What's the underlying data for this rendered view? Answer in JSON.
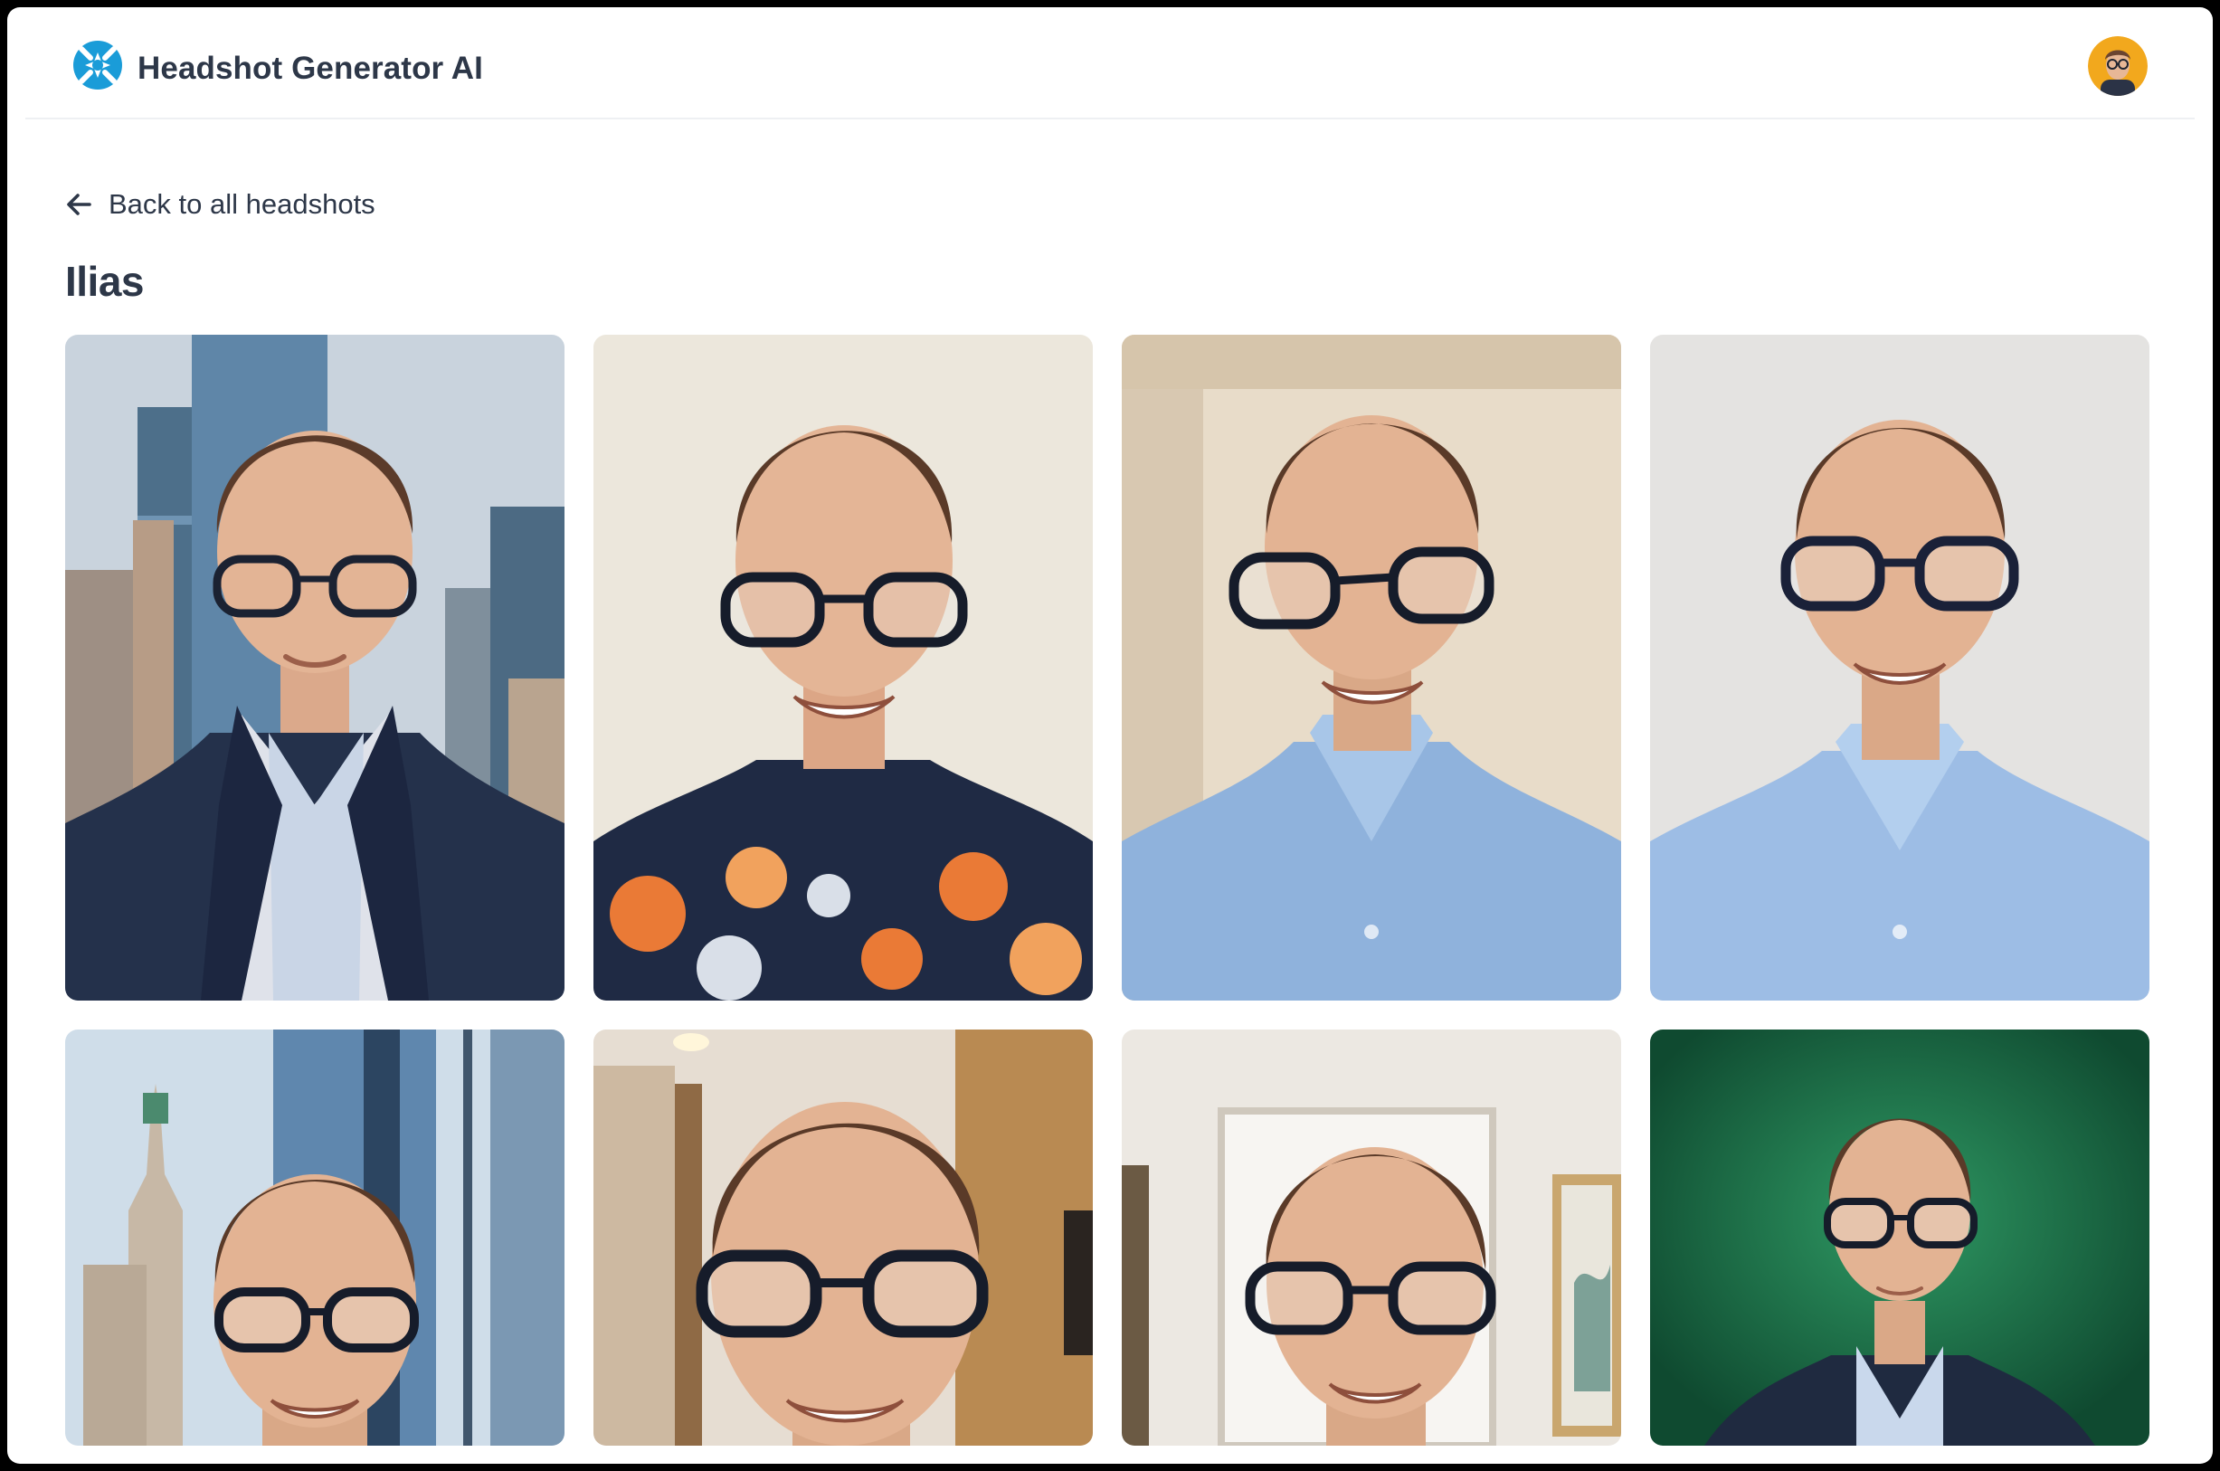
{
  "app": {
    "title": "Headshot Generator AI",
    "logo_icon": "headshot-generator-logo-icon",
    "accent": "#1a9cd8"
  },
  "user": {
    "avatar_icon": "user-avatar"
  },
  "nav": {
    "back_label": "Back to all headshots",
    "back_icon": "arrow-left-icon"
  },
  "page": {
    "title": "Ilias"
  },
  "headshots": [
    {
      "bg": "city-skyline",
      "outfit": "navy-blazer"
    },
    {
      "bg": "plain-cream-wall",
      "outfit": "floral-shirt"
    },
    {
      "bg": "beige-room",
      "outfit": "blue-shirt"
    },
    {
      "bg": "light-gray-wall",
      "outfit": "blue-shirt"
    },
    {
      "bg": "city-window",
      "outfit": "unknown"
    },
    {
      "bg": "office-interior",
      "outfit": "unknown"
    },
    {
      "bg": "gallery-wall",
      "outfit": "unknown"
    },
    {
      "bg": "green-studio",
      "outfit": "navy-blazer"
    }
  ]
}
